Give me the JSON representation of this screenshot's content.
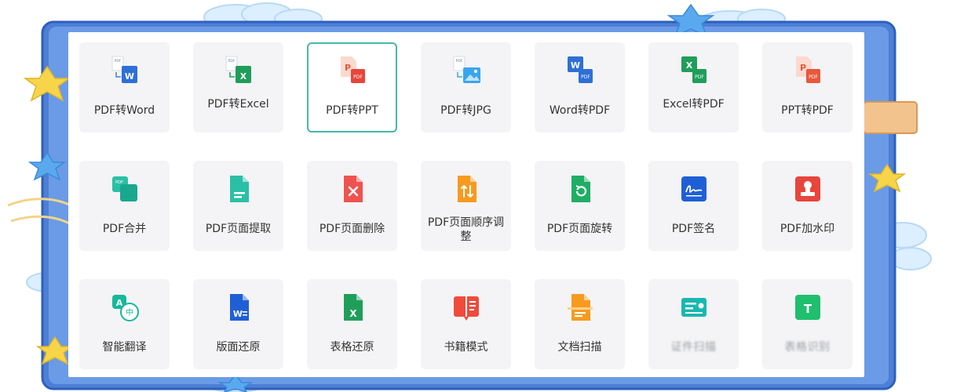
{
  "theme": {
    "frame_blue": "#4d7fd6",
    "frame_blue_dark": "#2f5fbf",
    "cloud": "#d9f0ff",
    "star": "#f7d54a",
    "tile_bg": "#f4f4f6",
    "selected_border": "#46b8ad"
  },
  "tools": [
    {
      "label": "PDF转Word",
      "icon": "pdf-to-word-icon"
    },
    {
      "label": "PDF转Excel",
      "icon": "pdf-to-excel-icon"
    },
    {
      "label": "PDF转PPT",
      "icon": "pdf-to-ppt-icon",
      "selected": true
    },
    {
      "label": "PDF转JPG",
      "icon": "pdf-to-jpg-icon"
    },
    {
      "label": "Word转PDF",
      "icon": "word-to-pdf-icon"
    },
    {
      "label": "Excel转PDF",
      "icon": "excel-to-pdf-icon"
    },
    {
      "label": "PPT转PDF",
      "icon": "ppt-to-pdf-icon"
    },
    {
      "label": "PDF合并",
      "icon": "pdf-merge-icon"
    },
    {
      "label": "PDF页面提取",
      "icon": "pdf-page-extract-icon"
    },
    {
      "label": "PDF页面删除",
      "icon": "pdf-page-delete-icon"
    },
    {
      "label": "PDF页面顺序调整",
      "icon": "pdf-page-reorder-icon"
    },
    {
      "label": "PDF页面旋转",
      "icon": "pdf-page-rotate-icon"
    },
    {
      "label": "PDF签名",
      "icon": "pdf-signature-icon"
    },
    {
      "label": "PDF加水印",
      "icon": "pdf-watermark-icon"
    },
    {
      "label": "智能翻译",
      "icon": "smart-translate-icon"
    },
    {
      "label": "版面还原",
      "icon": "layout-restore-icon"
    },
    {
      "label": "表格还原",
      "icon": "table-restore-icon"
    },
    {
      "label": "书籍模式",
      "icon": "book-mode-icon"
    },
    {
      "label": "文档扫描",
      "icon": "document-scan-icon"
    },
    {
      "label": "证件扫描",
      "icon": "id-card-scan-icon",
      "blurred": true
    },
    {
      "label": "表格识别",
      "icon": "table-recognition-icon",
      "blurred": true
    }
  ]
}
